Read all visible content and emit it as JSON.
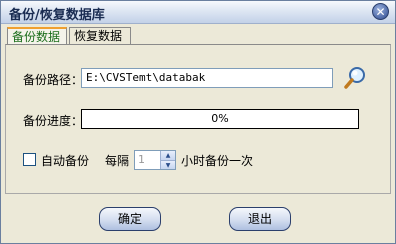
{
  "window": {
    "title": "备份/恢复数据库"
  },
  "tabs": [
    {
      "label": "备份数据"
    },
    {
      "label": "恢复数据"
    }
  ],
  "backup": {
    "path_label": "备份路径：",
    "path_value": "E:\\CVSTemt\\databak",
    "progress_label": "备份进度：",
    "progress_text": "0%",
    "progress_fraction": 0,
    "auto_label": "自动备份",
    "interval_prefix": "每隔",
    "interval_value": "1",
    "interval_suffix": "小时备份一次"
  },
  "buttons": {
    "ok_label": "确定",
    "exit_label": "退出"
  },
  "icons": {
    "close": "close-icon",
    "browse": "magnifier-icon"
  },
  "colors": {
    "title_text": "#1a2c52",
    "active_tab_text": "#1b6d1b",
    "button_border": "#2b3f6c"
  }
}
